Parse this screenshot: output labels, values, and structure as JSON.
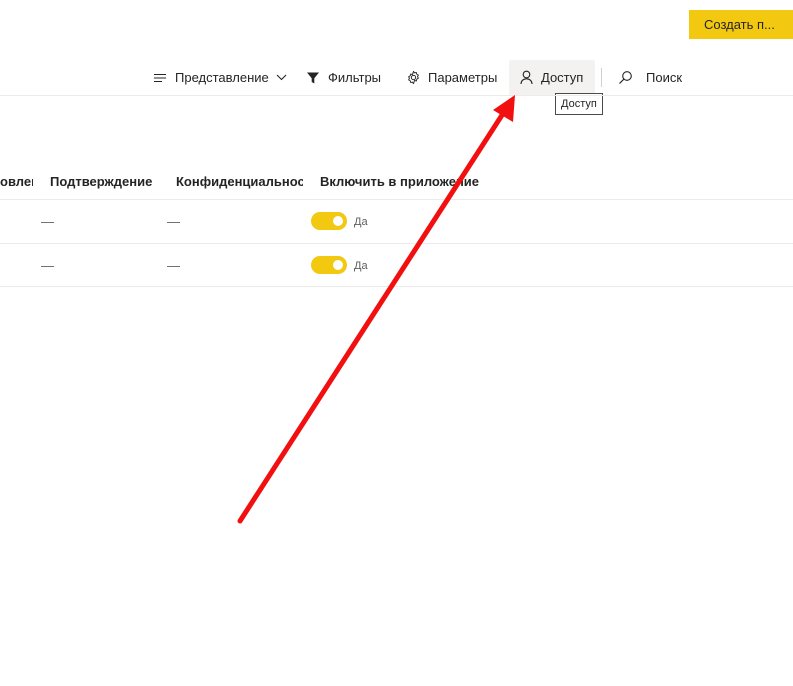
{
  "header": {
    "create_label": "Создать п..."
  },
  "toolbar": {
    "view_label": "Представление",
    "filters_label": "Фильтры",
    "settings_label": "Параметры",
    "access_label": "Доступ",
    "search_label": "Поиск",
    "tooltip": "Доступ"
  },
  "table": {
    "columns": [
      "овлен",
      "Подтверждение",
      "Конфиденциальность",
      "Включить в приложение"
    ],
    "rows": [
      {
        "endorsement": "—",
        "sensitivity": "—",
        "include_in_app": "Да",
        "include_on": true
      },
      {
        "endorsement": "—",
        "sensitivity": "—",
        "include_in_app": "Да",
        "include_on": true
      }
    ]
  },
  "colors": {
    "accent": "#F2C811",
    "arrow": "#F20F0F"
  },
  "icons": [
    "lines-icon",
    "chevron-down-icon",
    "filter-icon",
    "gear-icon",
    "person-icon",
    "search-icon"
  ]
}
